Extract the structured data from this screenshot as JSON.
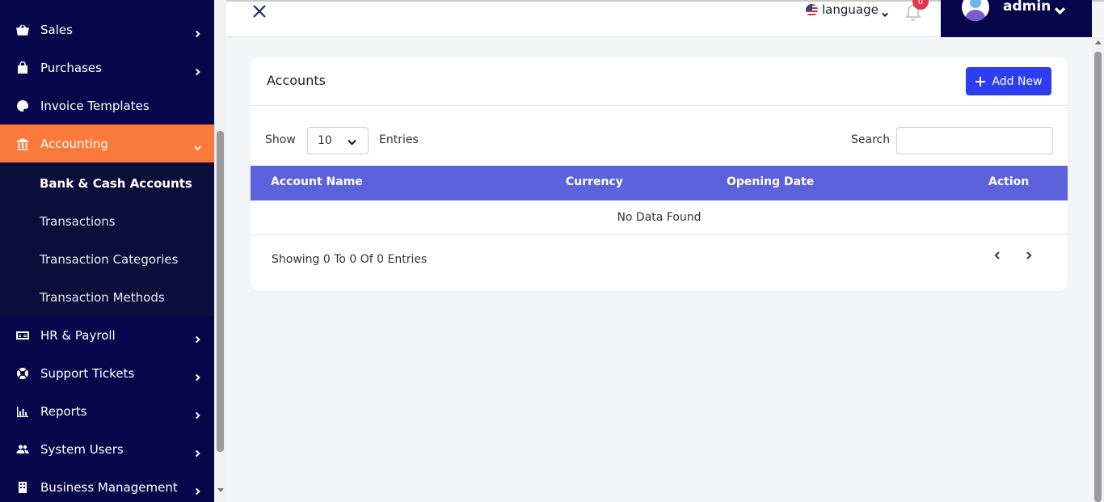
{
  "sidebar": {
    "items_before": [
      {
        "label": "Sales",
        "icon": "basket-icon"
      },
      {
        "label": "Purchases",
        "icon": "shopping-bag-icon"
      },
      {
        "label": "Invoice Templates",
        "icon": "palette-icon"
      }
    ],
    "active": {
      "label": "Accounting",
      "icon": "bank-icon"
    },
    "submenu": [
      {
        "label": "Bank & Cash Accounts",
        "current": true
      },
      {
        "label": "Transactions"
      },
      {
        "label": "Transaction Categories"
      },
      {
        "label": "Transaction Methods"
      }
    ],
    "items_after": [
      {
        "label": "HR & Payroll",
        "icon": "money-bill-icon"
      },
      {
        "label": "Support Tickets",
        "icon": "lifebuoy-icon"
      },
      {
        "label": "Reports",
        "icon": "bar-chart-icon"
      },
      {
        "label": "System Users",
        "icon": "users-icon"
      },
      {
        "label": "Business Management",
        "icon": "building-icon"
      }
    ]
  },
  "header": {
    "language_label": "language",
    "notification_count": "0",
    "user_name": "admin"
  },
  "card": {
    "title": "Accounts",
    "add_button": "Add New",
    "show_label": "Show",
    "entries_value": "10",
    "entries_label": "Entries",
    "search_label": "Search",
    "search_value": ""
  },
  "table": {
    "columns": [
      "Account Name",
      "Currency",
      "Opening Date",
      "Action"
    ],
    "empty_text": "No Data Found",
    "showing_text": "Showing 0 To 0 Of 0 Entries"
  },
  "colors": {
    "sidebar_bg": "#06074a",
    "active_item": "#fb7a3b",
    "table_header": "#5c62dc",
    "primary_button": "#2d3ef0",
    "badge": "#e5354b"
  }
}
